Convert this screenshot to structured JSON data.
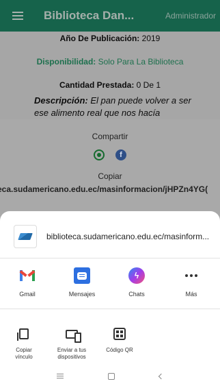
{
  "appbar": {
    "title": "Biblioteca Dan...",
    "role": "Administrador"
  },
  "book": {
    "year_label": "Año De Publicación:",
    "year_value": "2019",
    "availability_label": "Disponibilidad:",
    "availability_value": "Solo Para La Biblioteca",
    "loaned_label": "Cantidad Prestada:",
    "loaned_value": "0 De 1",
    "description_label": "Descripción:",
    "description_value": "El pan puede volver a ser ese alimento real que nos hacía"
  },
  "share_panel": {
    "title": "Compartir",
    "copy_label": "Copiar",
    "url": "eca.sudamericano.edu.ec/masinformacion/jHPZn4YG("
  },
  "sheet": {
    "link_text": "biblioteca.sudamericano.edu.ec/masinform...",
    "apps": [
      {
        "label": "Gmail",
        "icon": "gmail-icon"
      },
      {
        "label": "Mensajes",
        "icon": "messages-icon"
      },
      {
        "label": "Chats",
        "icon": "messenger-icon"
      },
      {
        "label": "Más",
        "icon": "more-icon"
      }
    ],
    "actions": [
      {
        "label_line1": "Copiar",
        "label_line2": "vínculo",
        "icon": "copy-icon"
      },
      {
        "label_line1": "Enviar a tus",
        "label_line2": "dispositivos",
        "icon": "devices-icon"
      },
      {
        "label_line1": "Código QR",
        "label_line2": "",
        "icon": "qr-code-icon"
      }
    ]
  },
  "colors": {
    "appbar": "#1f8a69",
    "availability": "#2a9c6c",
    "sheet_bg": "#ffffff"
  }
}
